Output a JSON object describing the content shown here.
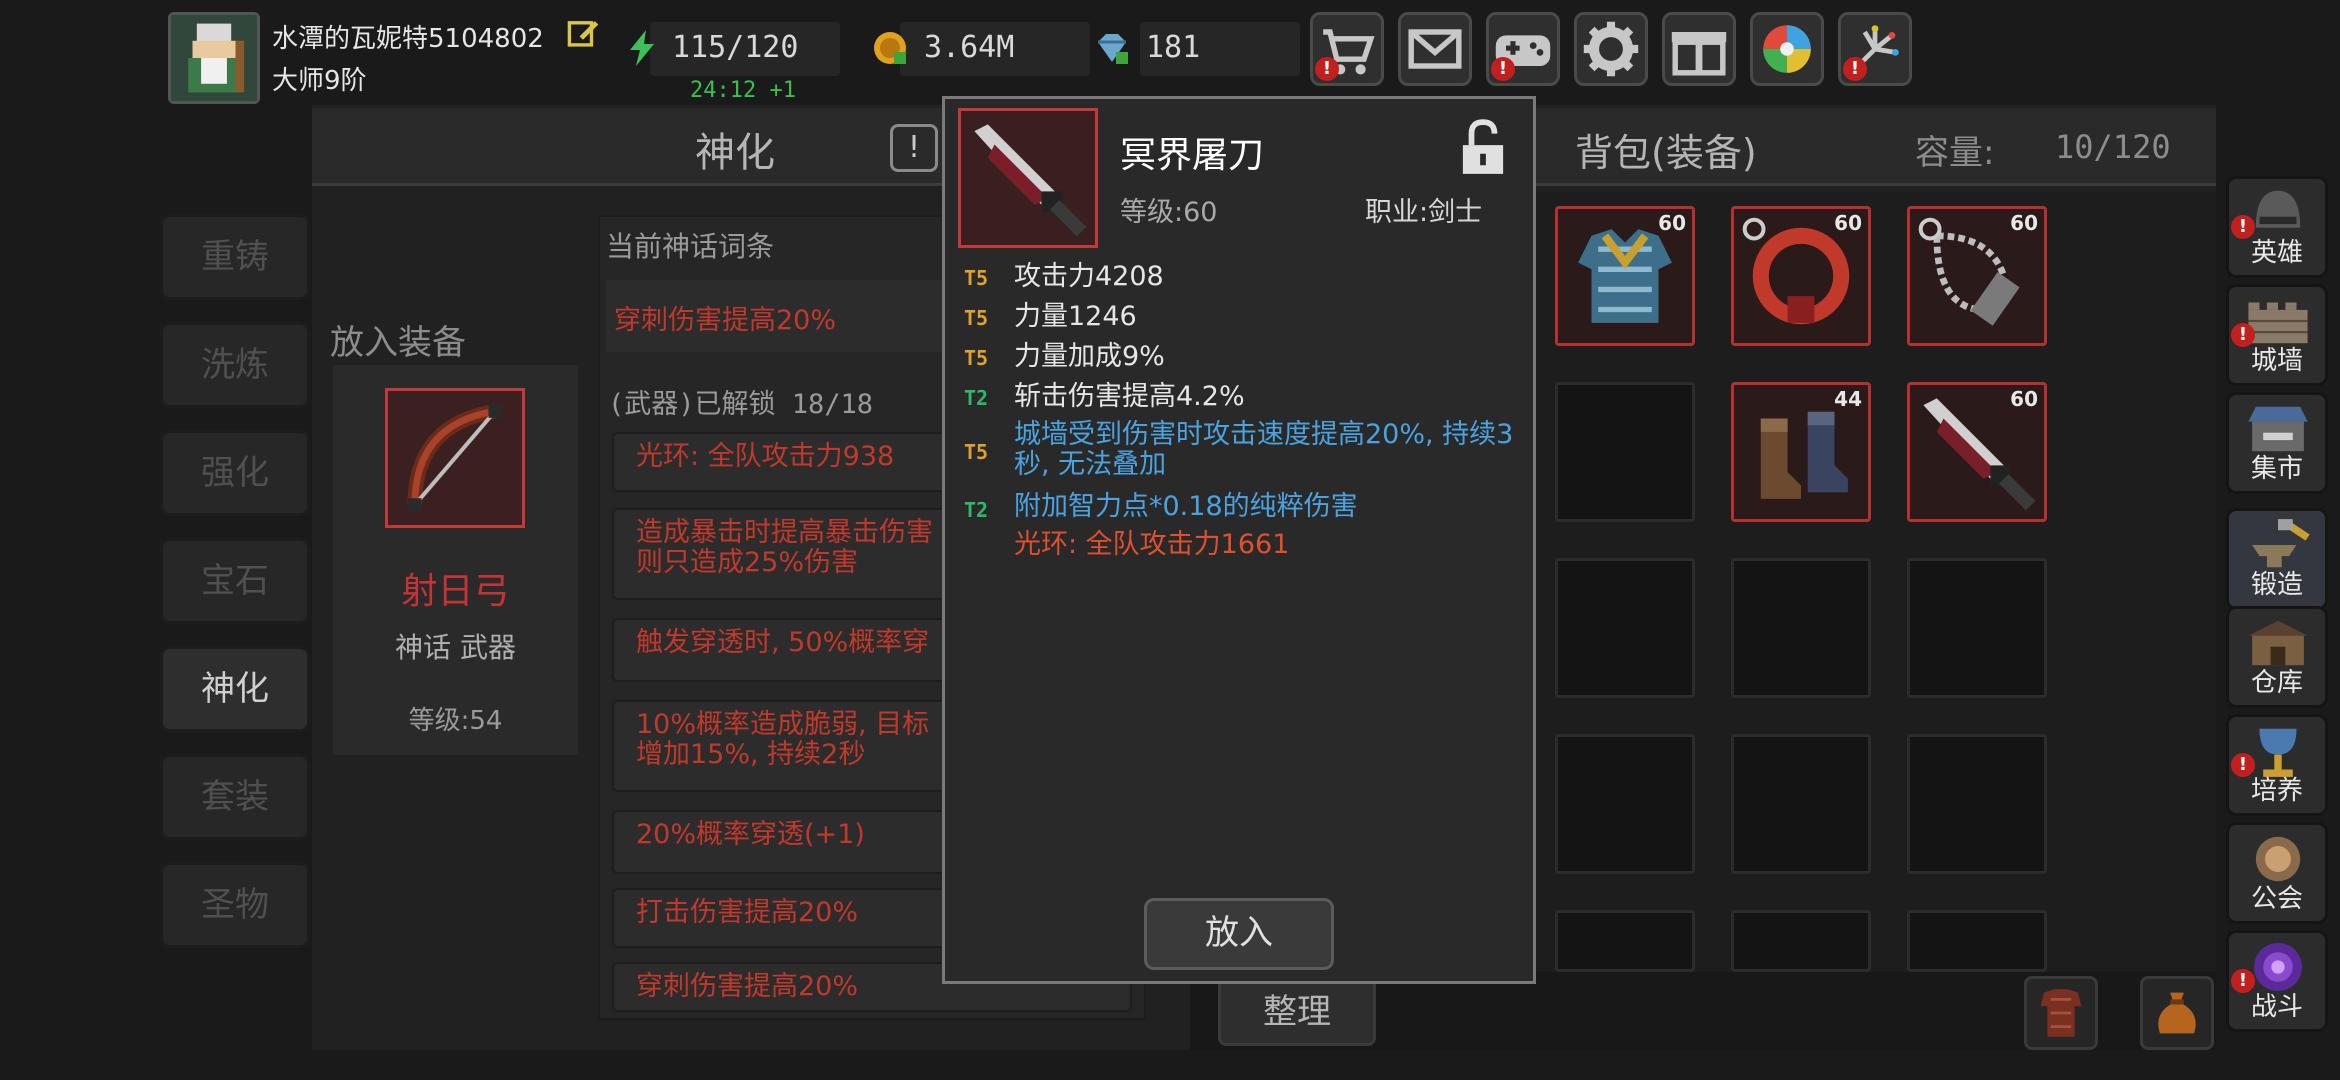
{
  "player": {
    "name": "水潭的瓦妮特5104802",
    "rank": "大师9阶"
  },
  "resources": {
    "stamina": "115/120",
    "stamina_timer": "24:12 +1",
    "gold": "3.64M",
    "gems": "181"
  },
  "top_buttons": [
    "shop-cart-icon",
    "mail-icon",
    "gamepad-icon",
    "settings-icon",
    "gift-icon",
    "lucky-wheel-icon",
    "fireworks-icon"
  ],
  "left_menu": {
    "items": [
      "重铸",
      "洗炼",
      "强化",
      "宝石",
      "神化",
      "套装",
      "圣物"
    ],
    "active": "神化"
  },
  "shenhua": {
    "title": "神化",
    "info": "!",
    "place_label": "放入装备",
    "equip_name": "射日弓",
    "equip_type": "神话 武器",
    "equip_level": "等级:54",
    "affix_title": "当前神话词条",
    "current_affix": "穿刺伤害提高20%",
    "unlock_label": "(武器)已解锁 18/18",
    "affixes": [
      "光环: 全队攻击力938",
      "造成暴击时提高暴击伤害\n则只造成25%伤害",
      "触发穿透时, 50%概率穿",
      "10%概率造成脆弱, 目标\n增加15%, 持续2秒",
      "20%概率穿透(+1)",
      "打击伤害提高20%",
      "穿刺伤害提高20%"
    ]
  },
  "bag": {
    "title": "背包(装备)",
    "capacity_label": "容量:",
    "capacity_value": "10/120",
    "sort_label": "整理",
    "items": [
      {
        "name": "chainmail-armor-icon",
        "level": "60"
      },
      {
        "name": "red-amulet-icon",
        "level": "60"
      },
      {
        "name": "chain-necklace-icon",
        "level": "60"
      },
      {
        "name": "boots-icon",
        "level": "44"
      },
      {
        "name": "netherworld-blade-icon",
        "level": "60"
      }
    ]
  },
  "right_nav": [
    "英雄",
    "城墙",
    "集市",
    "锻造",
    "仓库",
    "培养",
    "公会",
    "战斗"
  ],
  "tooltip": {
    "name": "冥界屠刀",
    "level": "等级:60",
    "class": "职业:剑士",
    "stats": [
      {
        "tier": "T5",
        "text": "攻击力4208",
        "color": "#e6e6e6"
      },
      {
        "tier": "T5",
        "text": "力量1246",
        "color": "#e6e6e6"
      },
      {
        "tier": "T5",
        "text": "力量加成9%",
        "color": "#e6e6e6"
      },
      {
        "tier": "T2",
        "text": "斩击伤害提高4.2%",
        "color": "#e6e6e6"
      },
      {
        "tier": "T5",
        "text": "城墙受到伤害时攻击速度提高20%, 持续3秒, 无法叠加",
        "color": "#4aa3e0"
      },
      {
        "tier": "T2",
        "text": "附加智力点*0.18的纯粹伤害",
        "color": "#4aa3e0"
      },
      {
        "tier": "",
        "text": "光环: 全队攻击力1661",
        "color": "#e0502f"
      }
    ],
    "tier_colors": {
      "T5": "#e0a030",
      "T2": "#2fb86a"
    },
    "put_button": "放入"
  }
}
